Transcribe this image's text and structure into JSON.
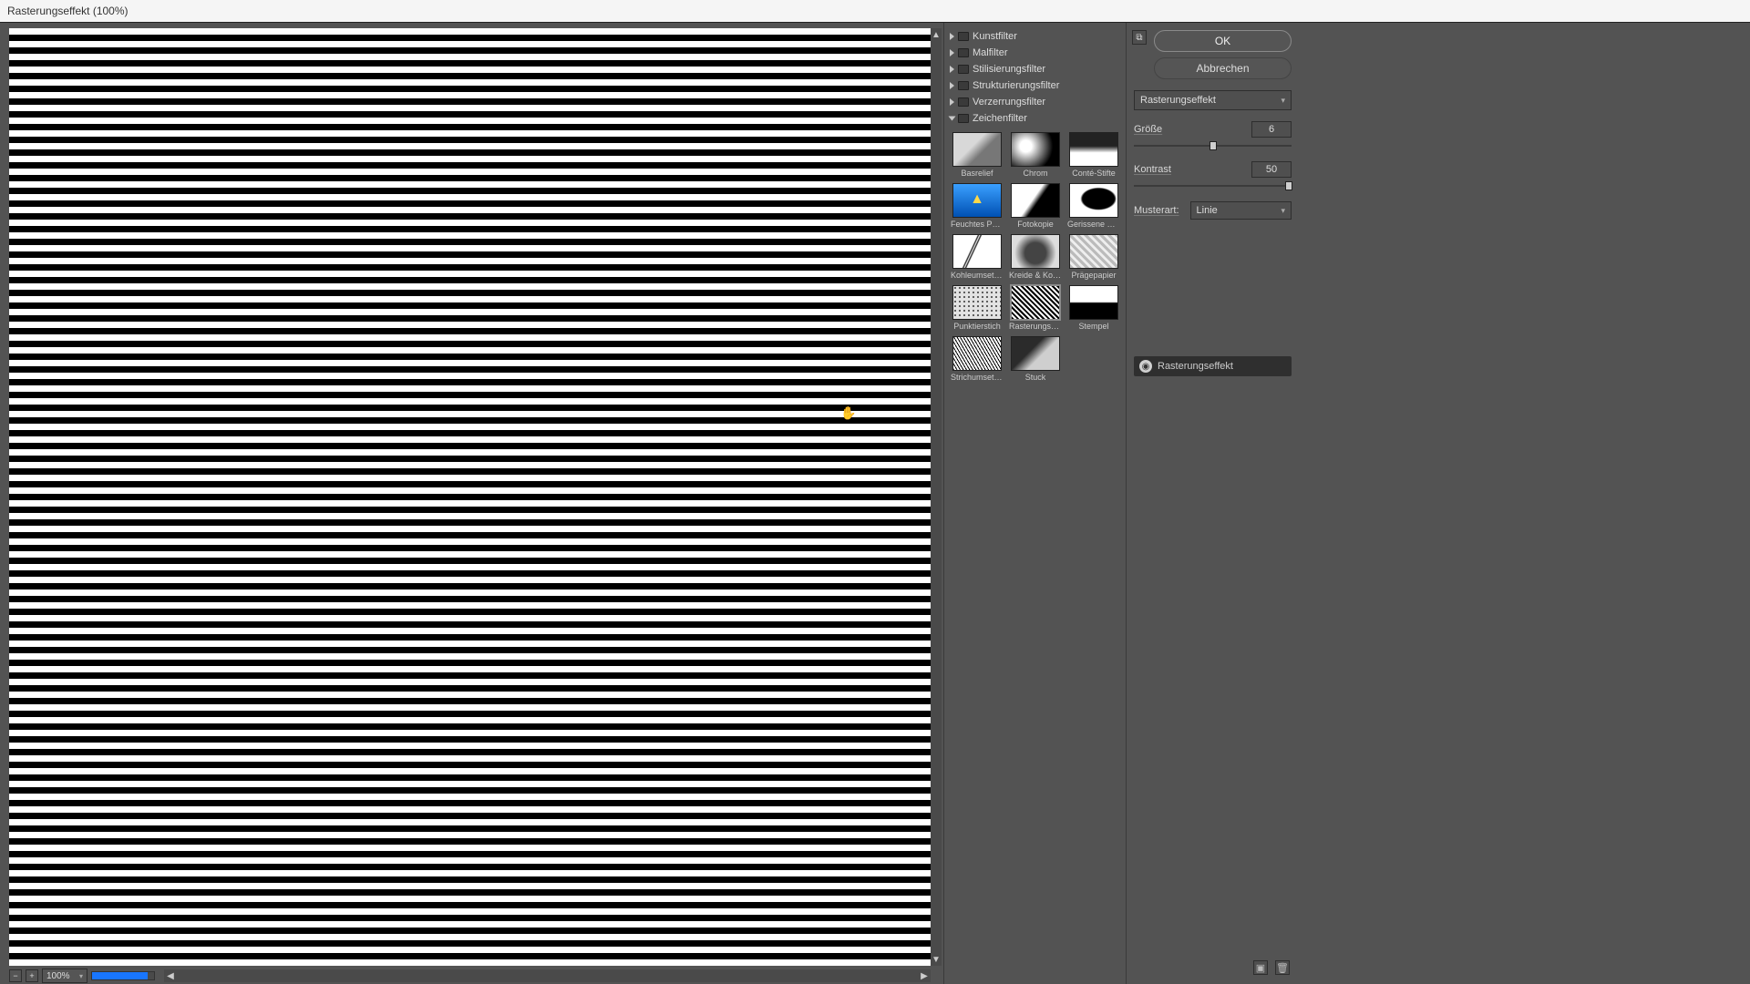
{
  "title": "Rasterungseffekt (100%)",
  "zoom": {
    "level": "100%"
  },
  "categories": [
    {
      "label": "Kunstfilter",
      "expanded": false
    },
    {
      "label": "Malfilter",
      "expanded": false
    },
    {
      "label": "Stilisierungsfilter",
      "expanded": false
    },
    {
      "label": "Strukturierungsfilter",
      "expanded": false
    },
    {
      "label": "Verzerrungsfilter",
      "expanded": false
    },
    {
      "label": "Zeichenfilter",
      "expanded": true
    }
  ],
  "thumbs": [
    {
      "label": "Basrelief"
    },
    {
      "label": "Chrom"
    },
    {
      "label": "Conté-Stifte"
    },
    {
      "label": "Feuchtes Papier"
    },
    {
      "label": "Fotokopie"
    },
    {
      "label": "Gerissene Kanten"
    },
    {
      "label": "Kohleumsetzung"
    },
    {
      "label": "Kreide & Kohle"
    },
    {
      "label": "Prägepapier"
    },
    {
      "label": "Punktierstich"
    },
    {
      "label": "Rasterungseffekt"
    },
    {
      "label": "Stempel"
    },
    {
      "label": "Strichumsetzung"
    },
    {
      "label": "Stuck"
    }
  ],
  "buttons": {
    "ok": "OK",
    "cancel": "Abbrechen"
  },
  "filter_dd": "Rasterungseffekt",
  "params": {
    "size_label": "Größe",
    "size_value": "6",
    "contrast_label": "Kontrast",
    "contrast_value": "50",
    "pattern_label": "Musterart:",
    "pattern_value": "Linie"
  },
  "layer": {
    "name": "Rasterungseffekt"
  }
}
